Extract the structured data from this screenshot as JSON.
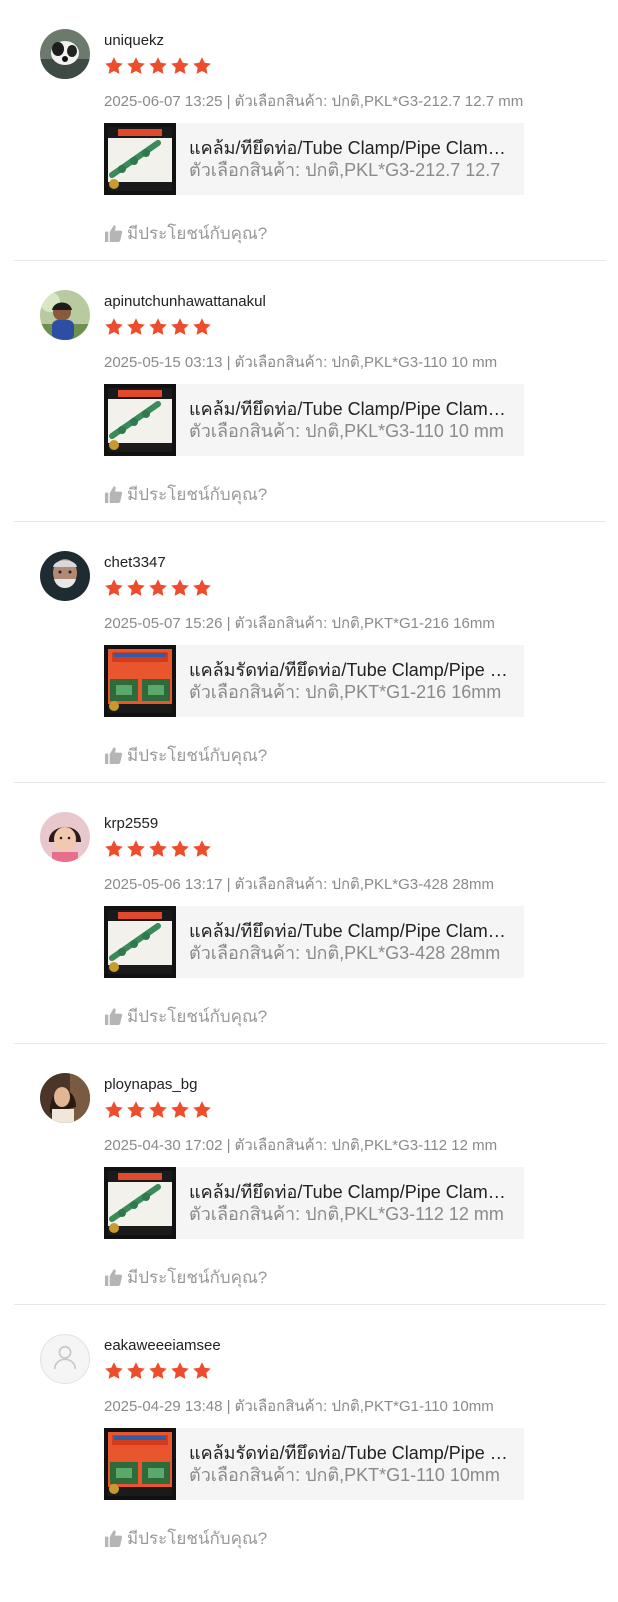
{
  "colors": {
    "star": "#ee4d2d",
    "meta_text": "#8a8a8a",
    "card_bg": "#f5f5f5",
    "divider": "#e8e8e8"
  },
  "icons": {
    "star": "star-icon",
    "like": "thumbs-up-icon",
    "default_avatar": "user-icon"
  },
  "reviews": [
    {
      "username": "uniquekz",
      "rating": 5,
      "meta": "2025-06-07 13:25 | ตัวเลือกสินค้า: ปกติ,PKL*G3-212.7 12.7 mm",
      "product_title": "แคล้ม/ทียึดท่อ/Tube Clamp/Pipe Clam…",
      "product_variant": "ตัวเลือกสินค้า: ปกติ,PKL*G3-212.7 12.7",
      "helpful_label": "มีประโยชน์กับคุณ?",
      "avatar": "photo-dog",
      "thumb": "clamp-white"
    },
    {
      "username": "apinutchunhawattanakul",
      "rating": 5,
      "meta": "2025-05-15 03:13 | ตัวเลือกสินค้า: ปกติ,PKL*G3-110 10 mm",
      "product_title": "แคล้ม/ทียึดท่อ/Tube Clamp/Pipe Clam…",
      "product_variant": "ตัวเลือกสินค้า: ปกติ,PKL*G3-110 10 mm",
      "helpful_label": "มีประโยชน์กับคุณ?",
      "avatar": "photo-person-outdoor",
      "thumb": "clamp-white"
    },
    {
      "username": "chet3347",
      "rating": 5,
      "meta": "2025-05-07 15:26 | ตัวเลือกสินค้า: ปกติ,PKT*G1-216 16mm",
      "product_title": "แคล้มรัดท่อ/ทียึดท่อ/Tube Clamp/Pipe …",
      "product_variant": "ตัวเลือกสินค้า: ปกติ,PKT*G1-216 16mm",
      "helpful_label": "มีประโยชน์กับคุณ?",
      "avatar": "photo-old-man",
      "thumb": "clamp-orange"
    },
    {
      "username": "krp2559",
      "rating": 5,
      "meta": "2025-05-06 13:17 | ตัวเลือกสินค้า: ปกติ,PKL*G3-428 28mm",
      "product_title": "แคล้ม/ทียึดท่อ/Tube Clamp/Pipe Clam…",
      "product_variant": "ตัวเลือกสินค้า: ปกติ,PKL*G3-428 28mm",
      "helpful_label": "มีประโยชน์กับคุณ?",
      "avatar": "photo-girl",
      "thumb": "clamp-white"
    },
    {
      "username": "ploynapas_bg",
      "rating": 5,
      "meta": "2025-04-30 17:02 | ตัวเลือกสินค้า: ปกติ,PKL*G3-112 12 mm",
      "product_title": "แคล้ม/ทียึดท่อ/Tube Clamp/Pipe Clam…",
      "product_variant": "ตัวเลือกสินค้า: ปกติ,PKL*G3-112 12 mm",
      "helpful_label": "มีประโยชน์กับคุณ?",
      "avatar": "photo-woman",
      "thumb": "clamp-white"
    },
    {
      "username": "eakaweeeiamsee",
      "rating": 5,
      "meta": "2025-04-29 13:48 | ตัวเลือกสินค้า: ปกติ,PKT*G1-110 10mm",
      "product_title": "แคล้มรัดท่อ/ทียึดท่อ/Tube Clamp/Pipe …",
      "product_variant": "ตัวเลือกสินค้า: ปกติ,PKT*G1-110 10mm",
      "helpful_label": "มีประโยชน์กับคุณ?",
      "avatar": "default",
      "thumb": "clamp-orange"
    }
  ]
}
